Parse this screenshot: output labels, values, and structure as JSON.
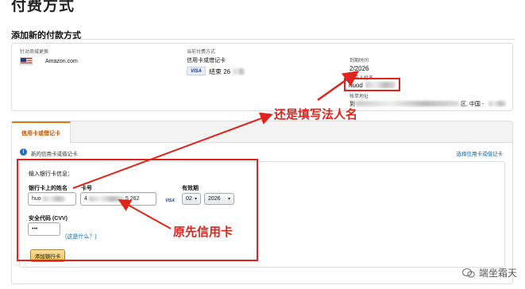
{
  "page": {
    "cut_title": "付费方式",
    "section_title": "添加新的付款方式"
  },
  "top_card": {
    "store_label": "针对商城更换",
    "store_name": "Amazon.com",
    "current_method_label": "当前付费方式",
    "card_type_label": "信用卡或借记卡",
    "card_brand": "VISA",
    "card_ending": "结束 26",
    "expiry_label": "到期时间",
    "expiry_value": "2/2026",
    "holder_label": "持卡人姓名",
    "holder_name": "huod",
    "address_label": "帐单地址",
    "address_prefix": "到",
    "address_suffix": "区, 中国 -"
  },
  "tabs": [
    {
      "label": "信用卡或借记卡",
      "active": true
    }
  ],
  "form": {
    "info_text": "新的信用卡或借记卡",
    "choose_link": "选择信用卡或借记卡",
    "heading": "输入银行卡信息：",
    "name_label": "银行卡上的姓名",
    "name_value": "huo",
    "card_label": "卡号",
    "card_value_start": "4",
    "card_value_end": "5 262",
    "card_brand_small": "VISA",
    "expiry_label": "有效期",
    "month_value": "02",
    "year_value": "2026",
    "cvv_label": "安全代码 (CVV)",
    "cvv_value": "•••",
    "cvv_help": "(这是什么？)",
    "add_button": "添加银行卡"
  },
  "annotations": {
    "note_name": "还是填写法人名",
    "note_card": "原先信用卡",
    "color": "#e0241b"
  },
  "watermark": {
    "text": "端坐霜天",
    "icon": "wechat-icon"
  },
  "colors": {
    "accent_tab": "#e47911",
    "link": "#0066c0",
    "button": "#f0c14b"
  }
}
